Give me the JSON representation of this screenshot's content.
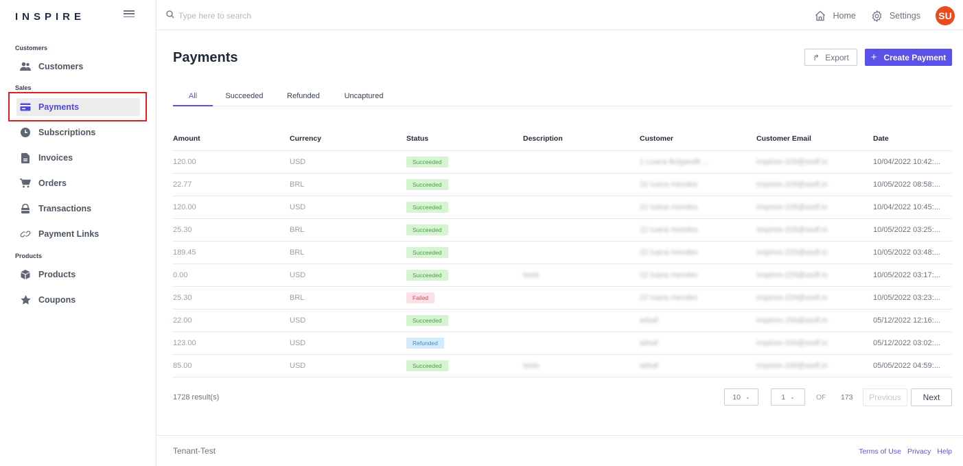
{
  "brand": {
    "name": "INSPIRE"
  },
  "sidebar": {
    "sections": [
      {
        "label": "Customers"
      },
      {
        "label": "Sales"
      },
      {
        "label": "Products"
      }
    ],
    "items": [
      {
        "label": "Customers",
        "icon": "users-icon"
      },
      {
        "label": "Payments",
        "icon": "credit-card-icon",
        "active": true
      },
      {
        "label": "Subscriptions",
        "icon": "clock-icon"
      },
      {
        "label": "Invoices",
        "icon": "document-icon"
      },
      {
        "label": "Orders",
        "icon": "cart-icon"
      },
      {
        "label": "Transactions",
        "icon": "lock-icon"
      },
      {
        "label": "Payment Links",
        "icon": "link-icon"
      },
      {
        "label": "Products",
        "icon": "box-icon"
      },
      {
        "label": "Coupons",
        "icon": "star-icon"
      }
    ]
  },
  "topbar": {
    "search_placeholder": "Type here to search",
    "home_label": "Home",
    "settings_label": "Settings",
    "avatar_initials": "SU"
  },
  "page": {
    "title": "Payments",
    "export_label": "Export",
    "create_label": "Create Payment"
  },
  "tabs": [
    {
      "label": "All",
      "active": true
    },
    {
      "label": "Succeeded"
    },
    {
      "label": "Refunded"
    },
    {
      "label": "Uncaptured"
    }
  ],
  "table": {
    "columns": [
      "Amount",
      "Currency",
      "Status",
      "Description",
      "Customer",
      "Customer Email",
      "Date"
    ],
    "rows": [
      {
        "amount": "120.00",
        "currency": "USD",
        "status": "Succeeded",
        "status_type": "succeeded",
        "description": "",
        "customer": "1 Luana Bulgarelli ...",
        "email": "inspires-229@asdf.io",
        "date": "10/04/2022 10:42:..."
      },
      {
        "amount": "22.77",
        "currency": "BRL",
        "status": "Succeeded",
        "status_type": "succeeded",
        "description": "",
        "customer": "22 luana mendes",
        "email": "inspires-229@asdf.io",
        "date": "10/05/2022 08:58:..."
      },
      {
        "amount": "120.00",
        "currency": "USD",
        "status": "Succeeded",
        "status_type": "succeeded",
        "description": "",
        "customer": "22 luana mendes",
        "email": "inspires-229@asdf.io",
        "date": "10/04/2022 10:45:..."
      },
      {
        "amount": "25.30",
        "currency": "BRL",
        "status": "Succeeded",
        "status_type": "succeeded",
        "description": "",
        "customer": "22 luana mendes",
        "email": "inspires-229@asdf.io",
        "date": "10/05/2022 03:25:..."
      },
      {
        "amount": "189.45",
        "currency": "BRL",
        "status": "Succeeded",
        "status_type": "succeeded",
        "description": "",
        "customer": "22 luana mendes",
        "email": "inspires-229@asdf.io",
        "date": "10/05/2022 03:48:..."
      },
      {
        "amount": "0.00",
        "currency": "USD",
        "status": "Succeeded",
        "status_type": "succeeded",
        "description": "teste",
        "customer": "22 luana mendes",
        "email": "inspires-229@asdf.io",
        "date": "10/05/2022 03:17:..."
      },
      {
        "amount": "25.30",
        "currency": "BRL",
        "status": "Failed",
        "status_type": "failed",
        "description": "",
        "customer": "22 luana mendes",
        "email": "inspires-229@asdf.io",
        "date": "10/05/2022 03:23:..."
      },
      {
        "amount": "22.00",
        "currency": "USD",
        "status": "Succeeded",
        "status_type": "succeeded",
        "description": "",
        "customer": "adsaf",
        "email": "inspires-156@asdf.io",
        "date": "05/12/2022 12:16:..."
      },
      {
        "amount": "123.00",
        "currency": "USD",
        "status": "Refunded",
        "status_type": "refunded",
        "description": "",
        "customer": "adsaf",
        "email": "inspires-156@asdf.io",
        "date": "05/12/2022 03:02:..."
      },
      {
        "amount": "85.00",
        "currency": "USD",
        "status": "Succeeded",
        "status_type": "succeeded",
        "description": "teste",
        "customer": "adsaf",
        "email": "inspires-156@asdf.io",
        "date": "05/05/2022 04:59:..."
      }
    ]
  },
  "pagination": {
    "results": "1728 result(s)",
    "page_size": "10",
    "page": "1",
    "of_label": "OF",
    "total_pages": "173",
    "previous_label": "Previous",
    "next_label": "Next"
  },
  "footer": {
    "tenant": "Tenant-Test",
    "links": [
      "Terms of Use",
      "Privacy",
      "Help"
    ]
  },
  "colors": {
    "accent": "#5b50e8",
    "avatar": "#ea4a1c",
    "highlight": "#e11d1d",
    "succeeded_bg": "#d6f3d2",
    "failed_bg": "#fde0e6",
    "refunded_bg": "#d4ebfb"
  }
}
